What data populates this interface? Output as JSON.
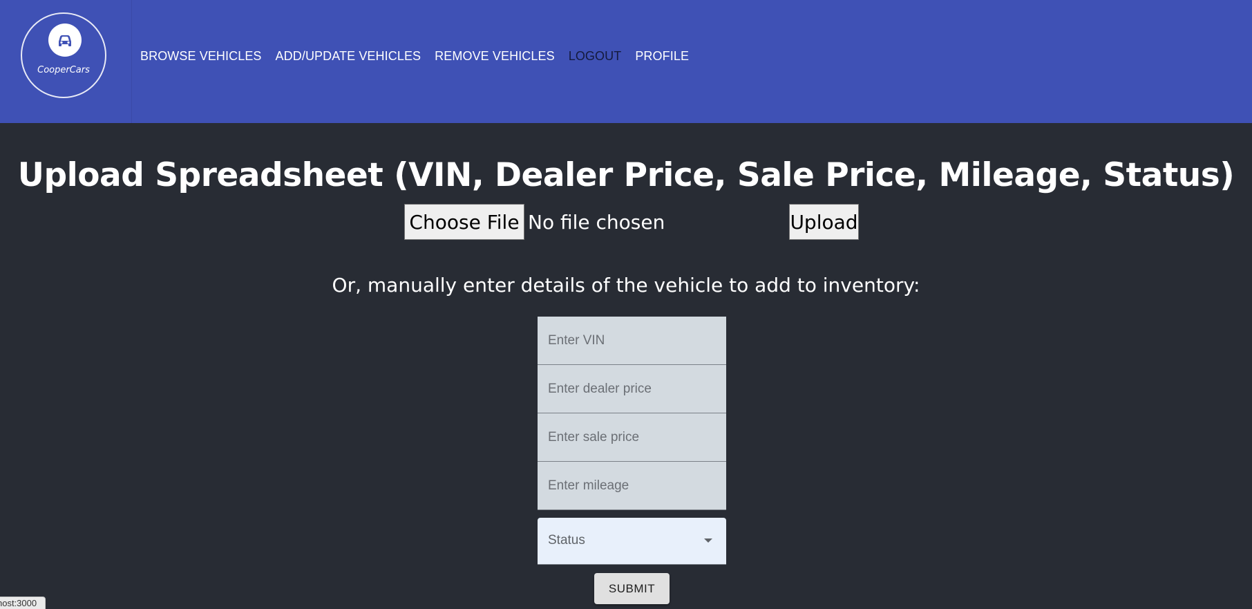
{
  "header": {
    "logo_text": "CooperCars",
    "nav": [
      {
        "label": "BROWSE VEHICLES"
      },
      {
        "label": "ADD/UPDATE VEHICLES"
      },
      {
        "label": "REMOVE VEHICLES"
      },
      {
        "label": "LOGOUT"
      },
      {
        "label": "PROFILE"
      }
    ],
    "colors": {
      "bar": "#3f51b5",
      "logout_text": "#141a3d"
    }
  },
  "main": {
    "title": "Upload Spreadsheet (VIN, Dealer Price, Sale Price, Mileage, Status)",
    "file_button_label": "Choose File",
    "file_status": "No file chosen",
    "upload_button_label": "Upload",
    "manual_label": "Or, manually enter details of the vehicle to add to inventory:",
    "fields": {
      "vin": {
        "placeholder": "Enter VIN",
        "value": ""
      },
      "dealer_price": {
        "placeholder": "Enter dealer price",
        "value": ""
      },
      "sale_price": {
        "placeholder": "Enter sale price",
        "value": ""
      },
      "mileage": {
        "placeholder": "Enter mileage",
        "value": ""
      }
    },
    "status_select": {
      "label": "Status",
      "icon": "chevron-down-icon"
    },
    "submit_label": "SUBMIT"
  },
  "statusbar": {
    "url": "host:3000"
  },
  "icons": {
    "logo": "car-icon"
  }
}
